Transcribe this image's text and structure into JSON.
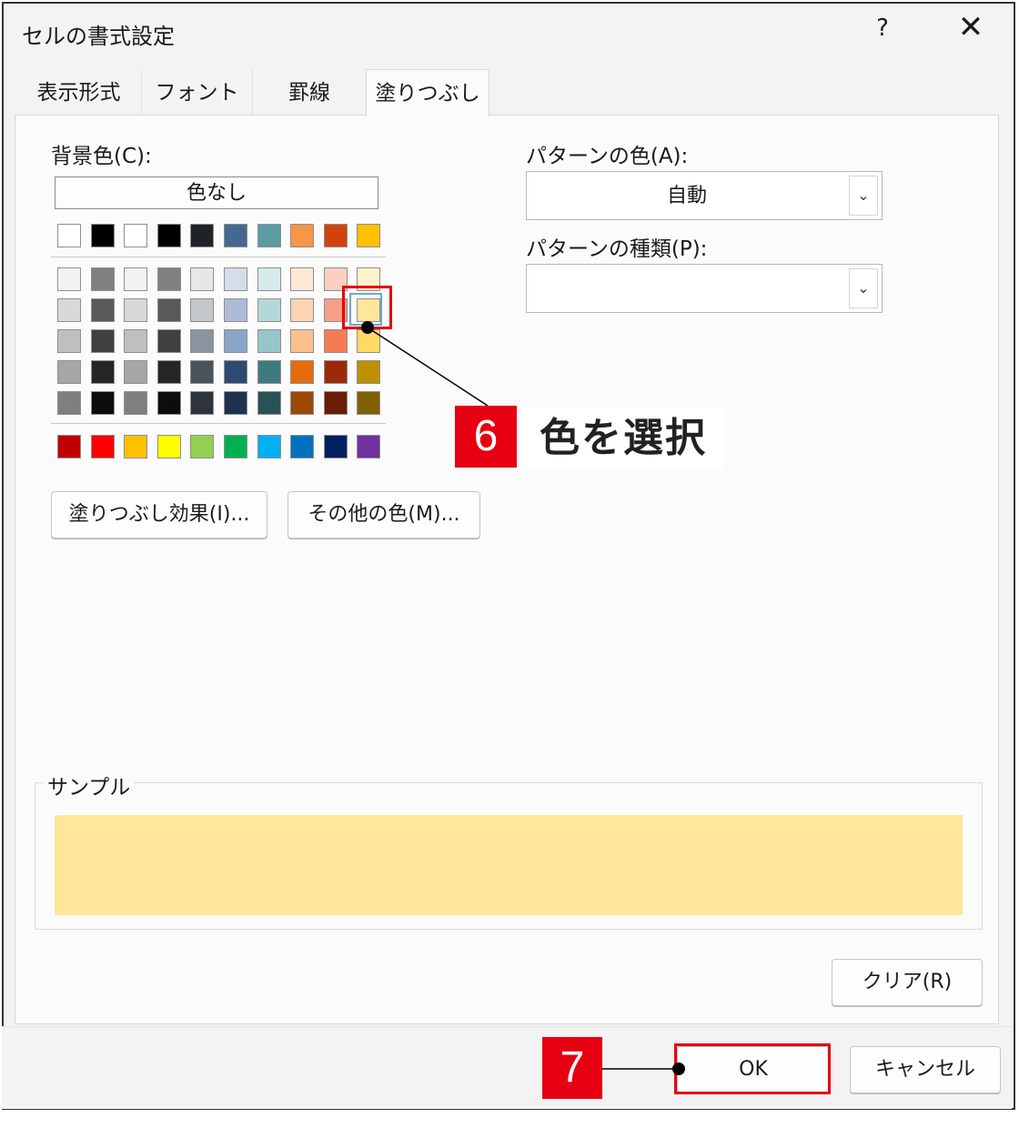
{
  "window": {
    "title": "セルの書式設定",
    "help": "?",
    "close": "✕"
  },
  "tabs": [
    "表示形式",
    "フォント",
    "罫線",
    "塗りつぶし"
  ],
  "active_tab": "塗りつぶし",
  "background": {
    "label": "背景色(C):",
    "no_color_label": "色なし",
    "theme_row": [
      "#ffffff",
      "#000000",
      "#ffffff",
      "#000000",
      "#1f2328",
      "#44698f",
      "#5b9ca4",
      "#f79646",
      "#d1420f",
      "#ffc000"
    ],
    "tint_grid": [
      [
        "#f2f2f2",
        "#808080",
        "#f2f2f2",
        "#808080",
        "#e7e7e7",
        "#d6dcea",
        "#d7eaeb",
        "#fde9d8",
        "#fbcfc1",
        "#fff2cc"
      ],
      [
        "#d8d8d8",
        "#595959",
        "#d8d8d8",
        "#595959",
        "#c3c7cc",
        "#adbcd5",
        "#b5d7d9",
        "#fbd4b4",
        "#f59f86",
        "#ffe699"
      ],
      [
        "#bfbfbf",
        "#404040",
        "#bfbfbf",
        "#404040",
        "#8a939e",
        "#8aa4c8",
        "#97c5c9",
        "#fabf8f",
        "#f57c52",
        "#ffd966"
      ],
      [
        "#a6a6a6",
        "#262626",
        "#a6a6a6",
        "#262626",
        "#4a525c",
        "#2e4a71",
        "#3f7a80",
        "#e46c0a",
        "#9c2a08",
        "#bf9000"
      ],
      [
        "#7f7f7f",
        "#0d0d0d",
        "#7f7f7f",
        "#0d0d0d",
        "#2e343b",
        "#1e3250",
        "#2a5156",
        "#9c4a06",
        "#6a1c06",
        "#806000"
      ]
    ],
    "standard_row": [
      "#c00000",
      "#ff0000",
      "#ffc000",
      "#ffff00",
      "#92d050",
      "#00b050",
      "#00b0f0",
      "#0070c0",
      "#002060",
      "#7030a0"
    ],
    "fill_effects_label": "塗りつぶし効果(I)...",
    "more_colors_label": "その他の色(M)..."
  },
  "pattern": {
    "color_label": "パターンの色(A):",
    "color_value": "自動",
    "type_label": "パターンの種類(P):",
    "type_value": ""
  },
  "sample": {
    "label": "サンプル",
    "color": "#ffe699"
  },
  "buttons": {
    "clear": "クリア(R)",
    "ok": "OK",
    "cancel": "キャンセル"
  },
  "annotations": {
    "step6_number": "6",
    "step6_text": "色を選択",
    "step7_number": "7"
  },
  "colors": {
    "accent_red": "#e60012"
  }
}
